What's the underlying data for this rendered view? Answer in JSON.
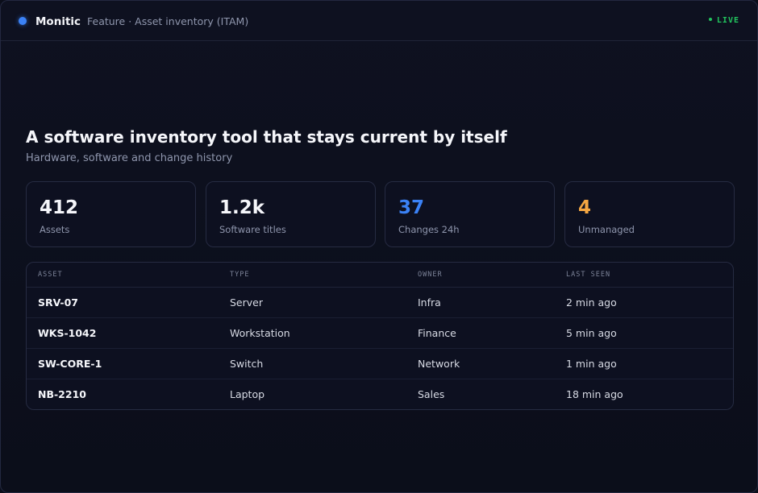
{
  "app": {
    "name": "Monitic",
    "breadcrumb": "Feature · Asset inventory (ITAM)",
    "status": "LIVE",
    "accent_color": "#3b82f6",
    "live_color": "#22c55e"
  },
  "hero": {
    "title": "A software inventory tool that stays current by itself",
    "subtitle": "Hardware, software and change history"
  },
  "stats": [
    {
      "value": "412",
      "label": "Assets",
      "color": "#f5f6fa"
    },
    {
      "value": "1.2k",
      "label": "Software titles",
      "color": "#f5f6fa"
    },
    {
      "value": "37",
      "label": "Changes 24h",
      "color": "#3b82f6"
    },
    {
      "value": "4",
      "label": "Unmanaged",
      "color": "#f5a742"
    }
  ],
  "table": {
    "columns": [
      "ASSET",
      "TYPE",
      "OWNER",
      "LAST SEEN"
    ],
    "rows": [
      {
        "asset": "SRV-07",
        "type": "Server",
        "owner": "Infra",
        "last_seen": "2 min ago"
      },
      {
        "asset": "WKS-1042",
        "type": "Workstation",
        "owner": "Finance",
        "last_seen": "5 min ago"
      },
      {
        "asset": "SW-CORE-1",
        "type": "Switch",
        "owner": "Network",
        "last_seen": "1 min ago"
      },
      {
        "asset": "NB-2210",
        "type": "Laptop",
        "owner": "Sales",
        "last_seen": "18 min ago"
      }
    ]
  }
}
